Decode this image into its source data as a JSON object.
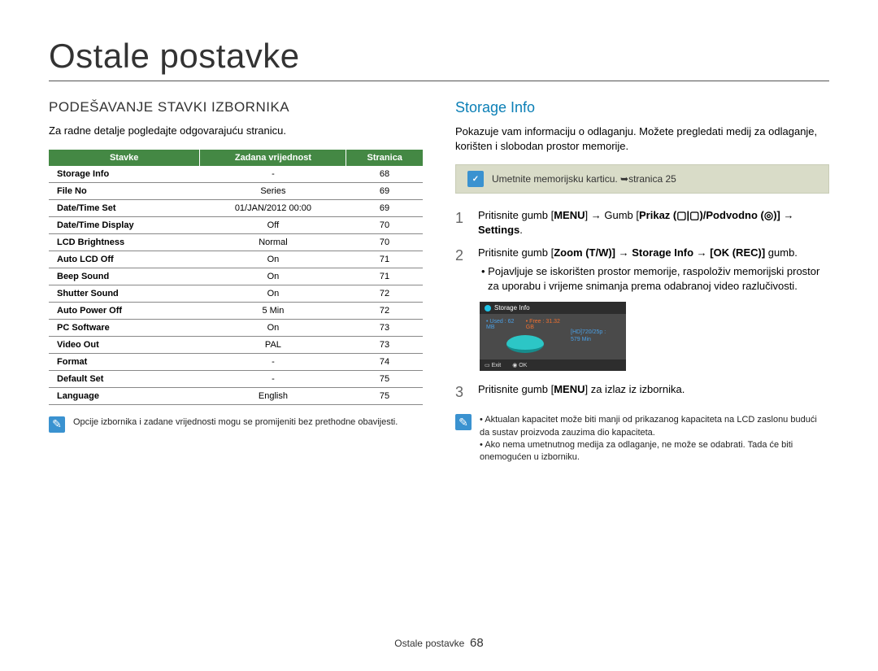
{
  "page": {
    "title": "Ostale postavke",
    "footer_label": "Ostale postavke",
    "page_number": "68"
  },
  "left": {
    "heading": "PODEŠAVANJE STAVKI IZBORNIKA",
    "intro": "Za radne detalje pogledajte odgovarajuću stranicu.",
    "table": {
      "headers": [
        "Stavke",
        "Zadana vrijednost",
        "Stranica"
      ],
      "rows": [
        [
          "Storage Info",
          "-",
          "68"
        ],
        [
          "File No",
          "Series",
          "69"
        ],
        [
          "Date/Time Set",
          "01/JAN/2012 00:00",
          "69"
        ],
        [
          "Date/Time Display",
          "Off",
          "70"
        ],
        [
          "LCD Brightness",
          "Normal",
          "70"
        ],
        [
          "Auto LCD Off",
          "On",
          "71"
        ],
        [
          "Beep Sound",
          "On",
          "71"
        ],
        [
          "Shutter Sound",
          "On",
          "72"
        ],
        [
          "Auto Power Off",
          "5 Min",
          "72"
        ],
        [
          "PC Software",
          "On",
          "73"
        ],
        [
          "Video Out",
          "PAL",
          "73"
        ],
        [
          "Format",
          "-",
          "74"
        ],
        [
          "Default Set",
          "-",
          "75"
        ],
        [
          "Language",
          "English",
          "75"
        ]
      ]
    },
    "note": "Opcije izbornika i zadane vrijednosti mogu se promijeniti bez prethodne obavijesti."
  },
  "right": {
    "heading": "Storage Info",
    "intro": "Pokazuje vam informaciju o odlaganju. Možete pregledati medij za odlaganje, korišten i slobodan prostor memorije.",
    "callout": "Umetnite memorijsku karticu. ➥stranica 25",
    "steps": {
      "s1a": "Pritisnite gumb ",
      "s1b": "MENU",
      "s1c": " → Gumb ",
      "s1d": "Prikaz (▢|▢)/Podvodno (◎)] → Settings",
      "s1e": ".",
      "s2a": "Pritisnite gumb [",
      "s2b": "Zoom (T/W)] → Storage Info → [OK (REC)]",
      "s2c": " gumb.",
      "s2_bullet": "Pojavljuje se iskorišten prostor memorije, raspoloživ memorijski prostor za uporabu i vrijeme snimanja prema odabranoj video razlučivosti.",
      "s3a": "Pritisnite gumb [",
      "s3b": "MENU",
      "s3c": "] za izlaz iz izbornika."
    },
    "lcd": {
      "title": "Storage Info",
      "used": "• Used : 62 MB",
      "free": "• Free : 31.32 GB",
      "res": "[HD]720/25p :",
      "min": "579 Min",
      "exit": "Exit",
      "ok": "OK"
    },
    "footnotes": {
      "a": "Aktualan kapacitet može biti manji od prikazanog kapaciteta na LCD zaslonu budući da sustav proizvoda zauzima dio kapaciteta.",
      "b": "Ako nema umetnutnog medija za odlaganje, ne može se odabrati. Tada će biti onemogućen u izborniku."
    }
  }
}
